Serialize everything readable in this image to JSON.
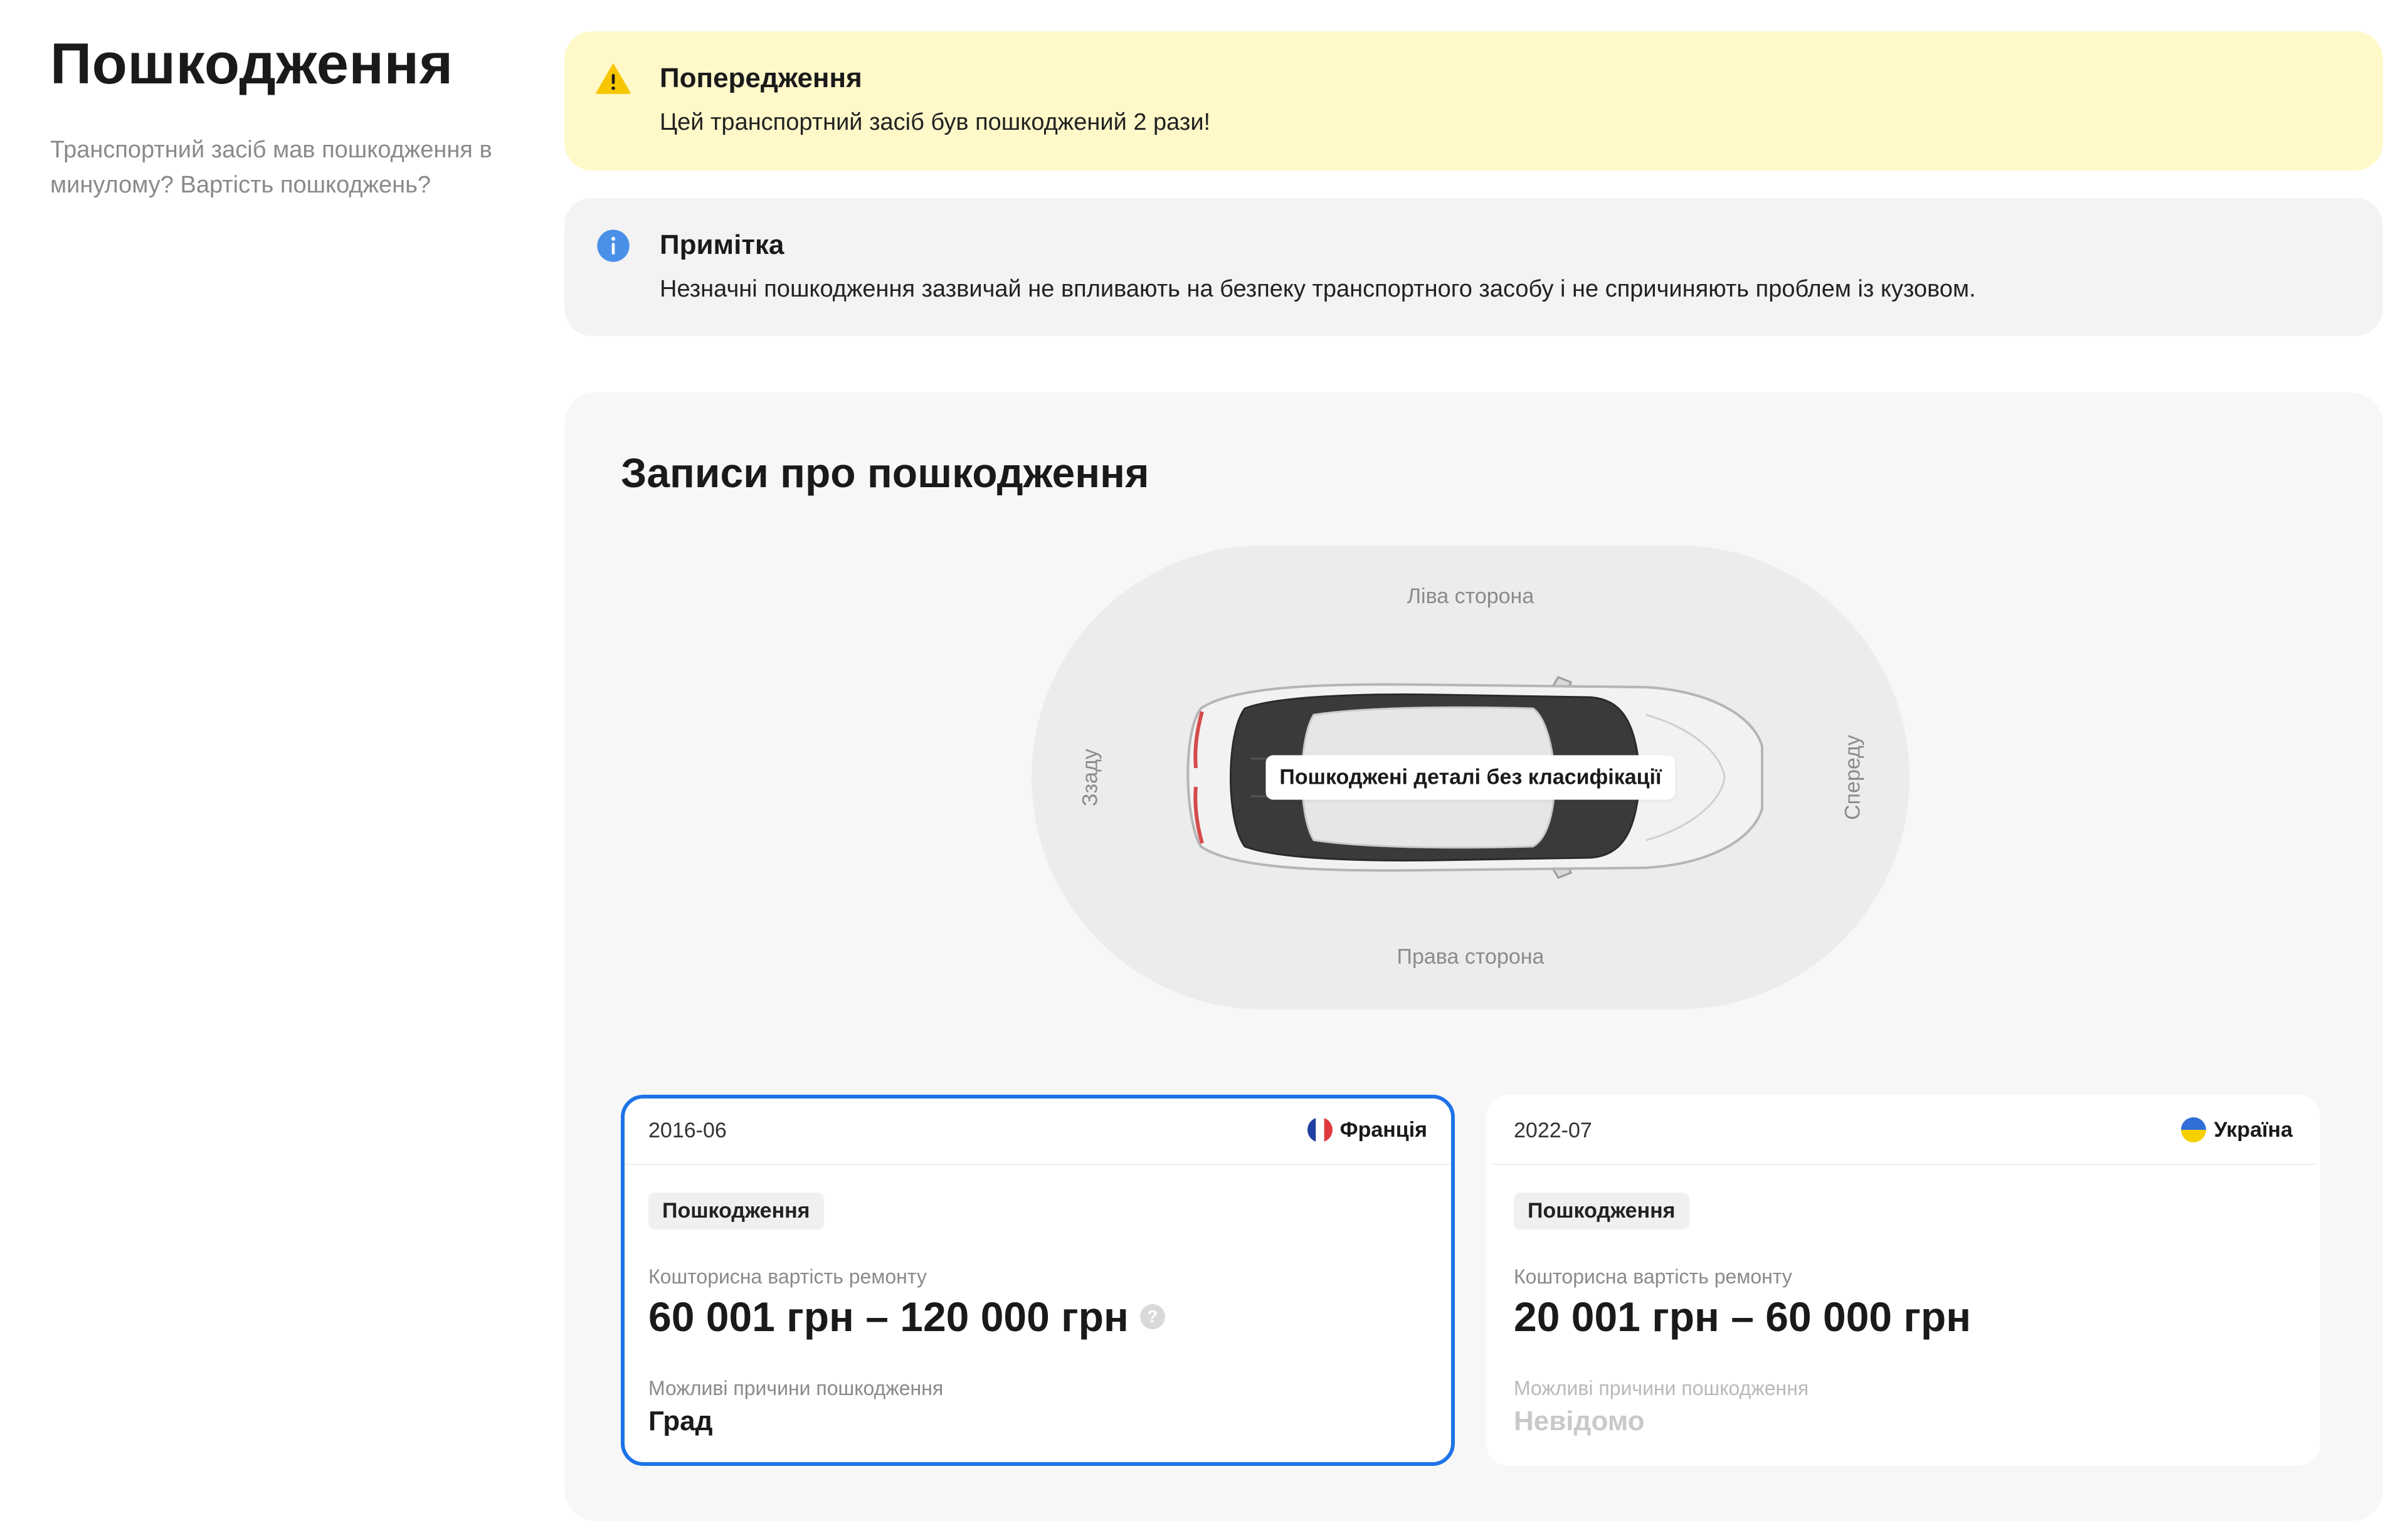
{
  "section": {
    "title": "Пошкодження",
    "subtitle": "Транспортний засіб мав пошкодження в минулому? Вартість пошкоджень?"
  },
  "warning": {
    "icon": "warning-icon",
    "title": "Попередження",
    "text": "Цей транспортний засіб був пошкоджений 2 рази!",
    "color": "#fff8c9"
  },
  "note": {
    "icon": "info-icon",
    "title": "Примітка",
    "text": "Незначні пошкодження зазвичай не впливають на безпеку транспортного засобу і не спричиняють проблем із кузовом."
  },
  "records": {
    "title": "Записи про пошкодження",
    "diagram": {
      "left_side": "Ліва сторона",
      "right_side": "Права сторона",
      "rear": "Ззаду",
      "front": "Спереду",
      "badge": "Пошкоджені деталі без класифікації"
    },
    "cards": [
      {
        "date": "2016-06",
        "country": "Франція",
        "flag": "flag-france-icon",
        "type": "Пошкодження",
        "estimate_label": "Кошторисна вартість ремонту",
        "estimate_value": "60 001 грн – 120 000 грн",
        "cause_label": "Можливі причини пошкодження",
        "cause_value": "Град",
        "selected": true
      },
      {
        "date": "2022-07",
        "country": "Україна",
        "flag": "flag-ukraine-icon",
        "type": "Пошкодження",
        "estimate_label": "Кошторисна вартість ремонту",
        "estimate_value": "20 001 грн – 60 000 грн",
        "cause_label": "Можливі причини пошкодження",
        "cause_value": "Невідомо",
        "selected": false
      }
    ],
    "selected_color": "#1e73e8"
  }
}
